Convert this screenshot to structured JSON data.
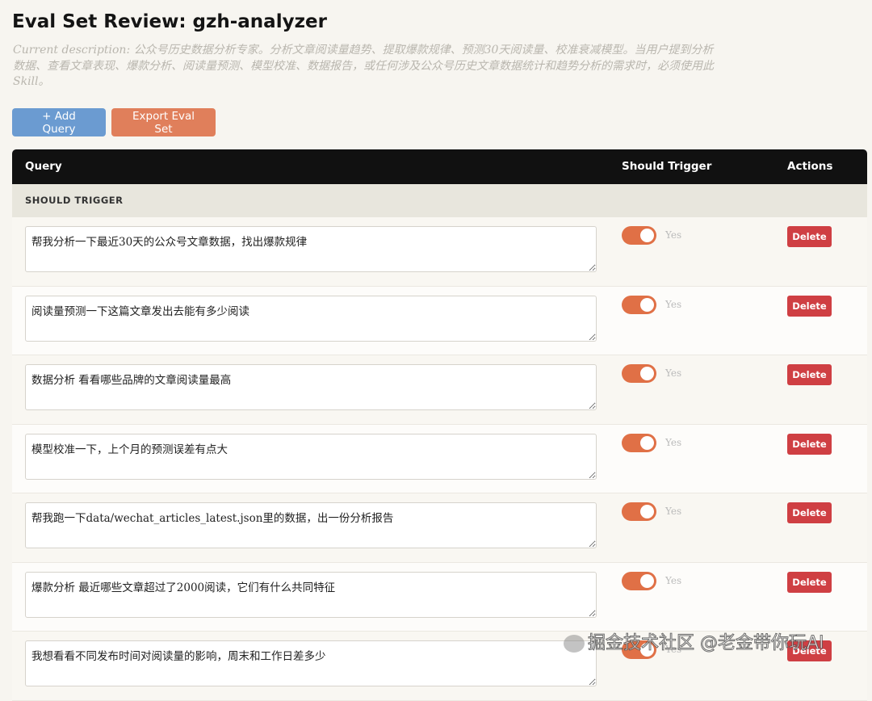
{
  "title": "Eval Set Review: gzh-analyzer",
  "description": "Current description: 公众号历史数据分析专家。分析文章阅读量趋势、提取爆款规律、预测30天阅读量、校准衰减模型。当用户提到分析数据、查看文章表现、爆款分析、阅读量预测、模型校准、数据报告，或任何涉及公众号历史文章数据统计和趋势分析的需求时，必须使用此Skill。",
  "toolbar": {
    "add": "+ Add Query",
    "export": "Export Eval Set"
  },
  "table": {
    "headers": {
      "query": "Query",
      "trigger": "Should Trigger",
      "actions": "Actions"
    },
    "section": "SHOULD TRIGGER",
    "rows": [
      {
        "query": "帮我分析一下最近30天的公众号文章数据，找出爆款规律",
        "trigger": "Yes",
        "delete": "Delete"
      },
      {
        "query": "阅读量预测一下这篇文章发出去能有多少阅读",
        "trigger": "Yes",
        "delete": "Delete"
      },
      {
        "query": "数据分析 看看哪些品牌的文章阅读量最高",
        "trigger": "Yes",
        "delete": "Delete"
      },
      {
        "query": "模型校准一下，上个月的预测误差有点大",
        "trigger": "Yes",
        "delete": "Delete"
      },
      {
        "query": "帮我跑一下data/wechat_articles_latest.json里的数据，出一份分析报告",
        "trigger": "Yes",
        "delete": "Delete"
      },
      {
        "query": "爆款分析 最近哪些文章超过了2000阅读，它们有什么共同特征",
        "trigger": "Yes",
        "delete": "Delete"
      },
      {
        "query": "我想看看不同发布时间对阅读量的影响，周末和工作日差多少",
        "trigger": "Yes",
        "delete": "Delete"
      }
    ]
  },
  "watermark": "掘金技术社区 @老金带你玩AI"
}
